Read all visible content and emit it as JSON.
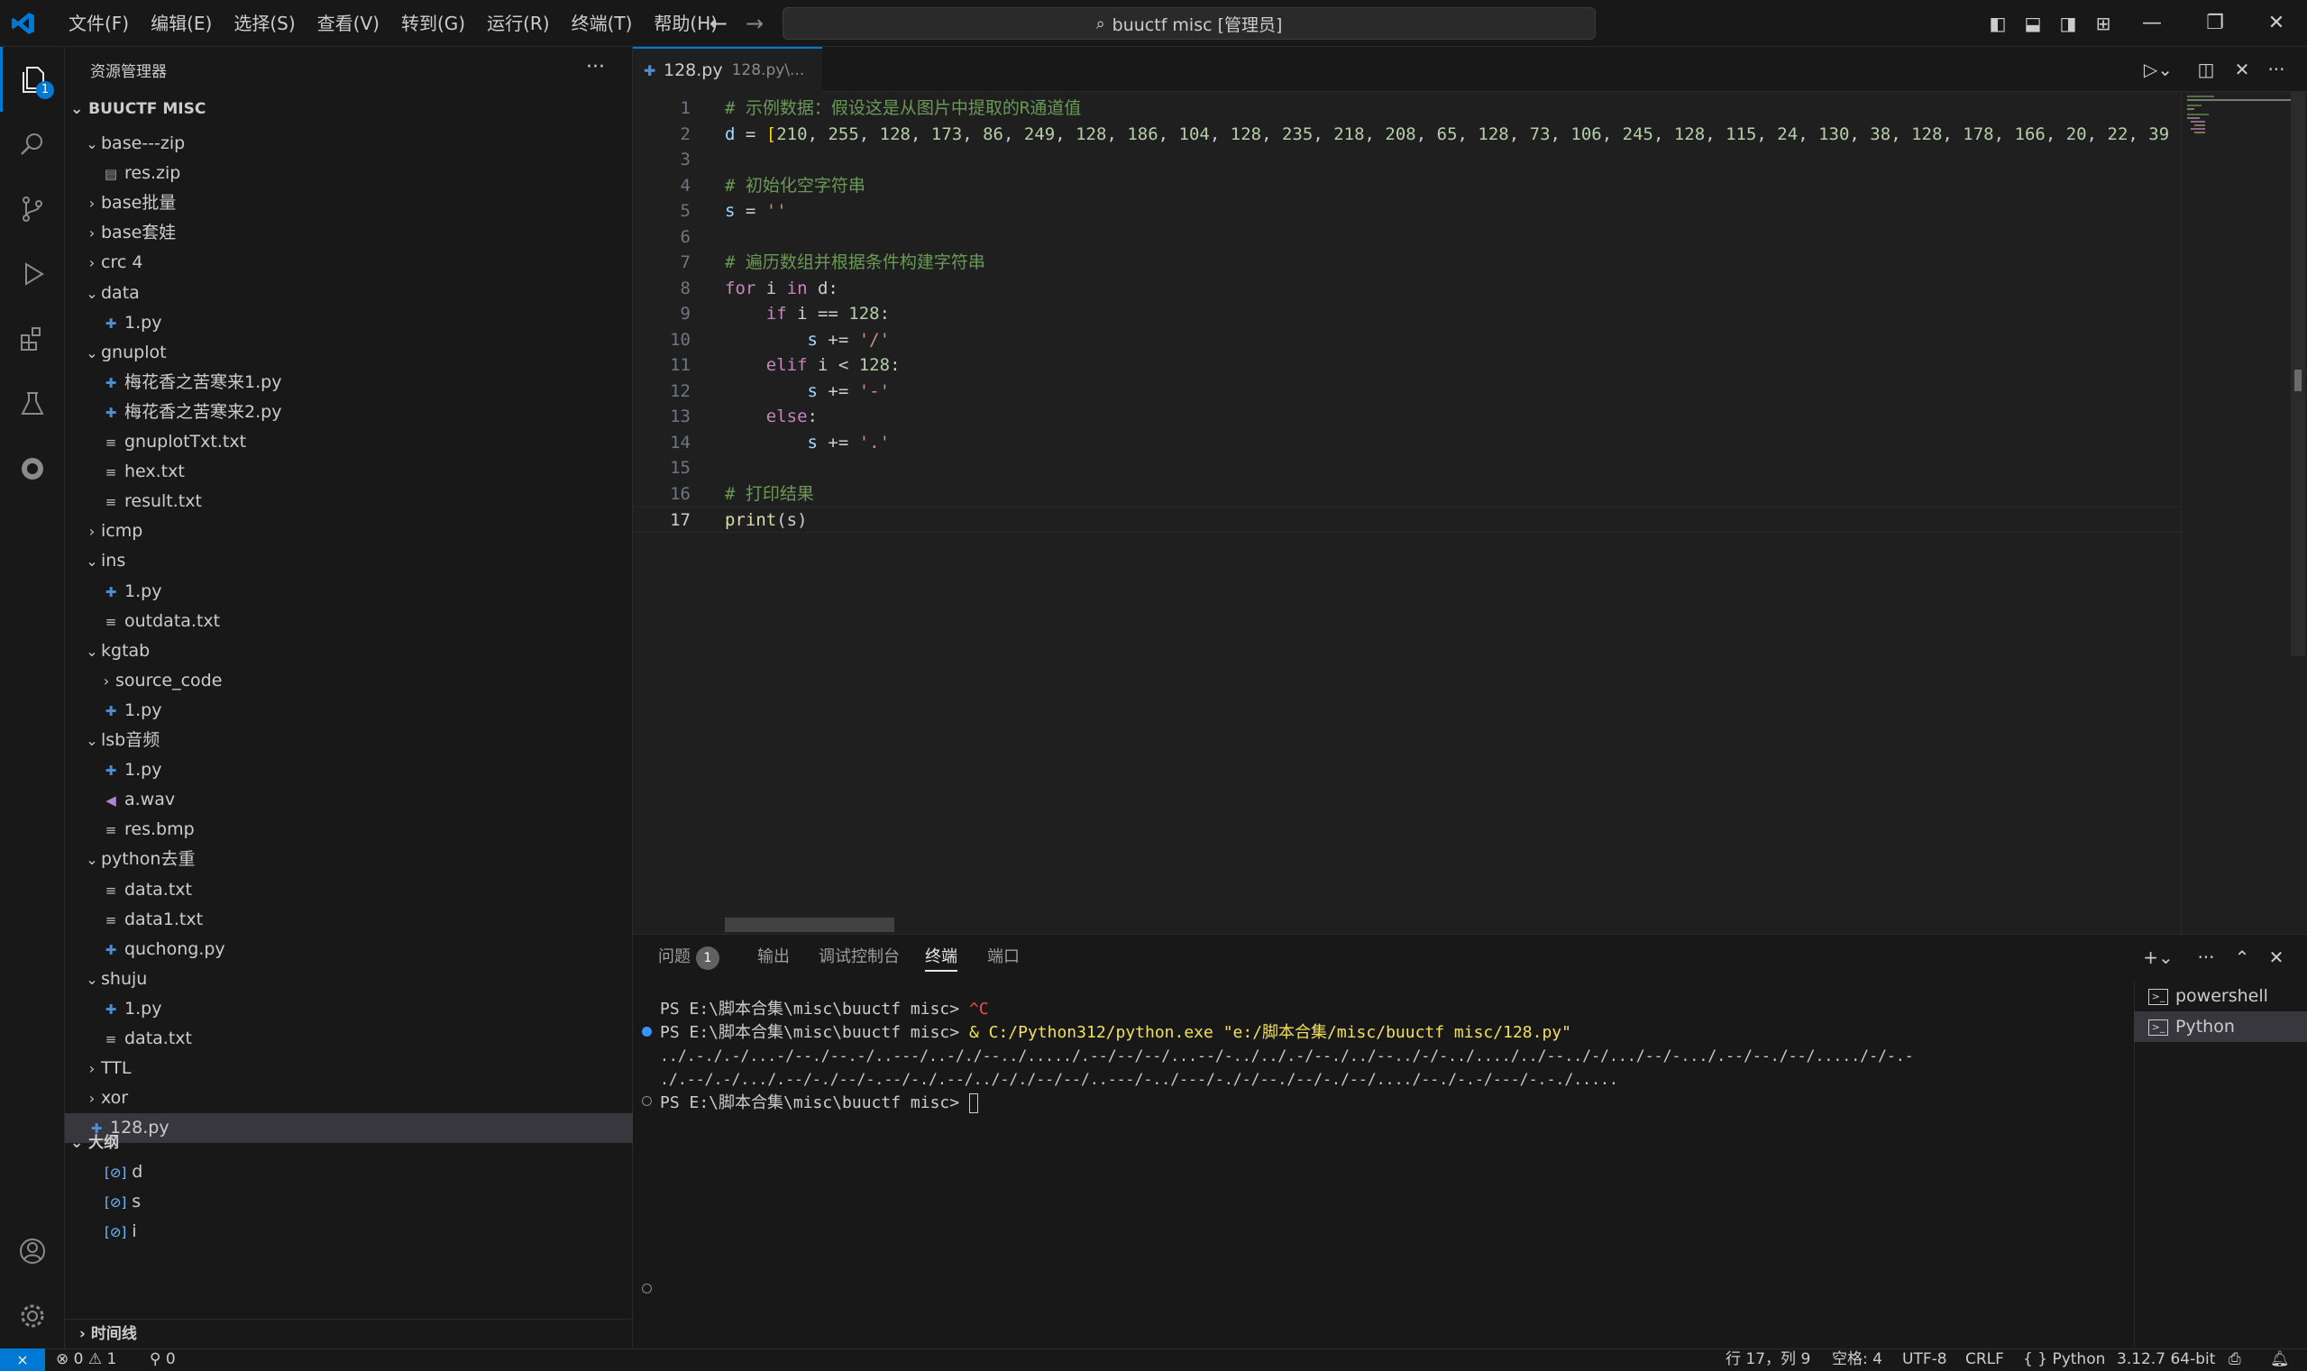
{
  "menu": [
    "文件(F)",
    "编辑(E)",
    "选择(S)",
    "查看(V)",
    "转到(G)",
    "运行(R)",
    "终端(T)",
    "帮助(H)"
  ],
  "command_center": "buuctf misc [管理员]",
  "activity": {
    "explorer_badge": "1"
  },
  "sidebar": {
    "title": "资源管理器",
    "more": "···",
    "section": "BUUCTF MISC",
    "tree": [
      {
        "label": "base---zip",
        "type": "folder-open",
        "depth": 0
      },
      {
        "label": "res.zip",
        "type": "zip",
        "depth": 1
      },
      {
        "label": "base批量",
        "type": "folder",
        "depth": 0
      },
      {
        "label": "base套娃",
        "type": "folder",
        "depth": 0
      },
      {
        "label": "crc 4",
        "type": "folder",
        "depth": 0
      },
      {
        "label": "data",
        "type": "folder-open",
        "depth": 0
      },
      {
        "label": "1.py",
        "type": "py",
        "depth": 1
      },
      {
        "label": "gnuplot",
        "type": "folder-open",
        "depth": 0
      },
      {
        "label": "梅花香之苦寒来1.py",
        "type": "py",
        "depth": 1
      },
      {
        "label": "梅花香之苦寒来2.py",
        "type": "py",
        "depth": 1
      },
      {
        "label": "gnuplotTxt.txt",
        "type": "txt",
        "depth": 1
      },
      {
        "label": "hex.txt",
        "type": "txt",
        "depth": 1
      },
      {
        "label": "result.txt",
        "type": "txt",
        "depth": 1
      },
      {
        "label": "icmp",
        "type": "folder",
        "depth": 0
      },
      {
        "label": "ins",
        "type": "folder-open",
        "depth": 0
      },
      {
        "label": "1.py",
        "type": "py",
        "depth": 1
      },
      {
        "label": "outdata.txt",
        "type": "txt",
        "depth": 1
      },
      {
        "label": "kgtab",
        "type": "folder-open",
        "depth": 0
      },
      {
        "label": "source_code",
        "type": "folder",
        "depth": 1
      },
      {
        "label": "1.py",
        "type": "py",
        "depth": 1
      },
      {
        "label": "lsb音频",
        "type": "folder-open",
        "depth": 0
      },
      {
        "label": "1.py",
        "type": "py",
        "depth": 1
      },
      {
        "label": "a.wav",
        "type": "wav",
        "depth": 1
      },
      {
        "label": "res.bmp",
        "type": "txt",
        "depth": 1
      },
      {
        "label": "python去重",
        "type": "folder-open",
        "depth": 0
      },
      {
        "label": "data.txt",
        "type": "txt",
        "depth": 1
      },
      {
        "label": "data1.txt",
        "type": "txt",
        "depth": 1
      },
      {
        "label": "quchong.py",
        "type": "py",
        "depth": 1
      },
      {
        "label": "shuju",
        "type": "folder-open",
        "depth": 0
      },
      {
        "label": "1.py",
        "type": "py",
        "depth": 1
      },
      {
        "label": "data.txt",
        "type": "txt",
        "depth": 1
      },
      {
        "label": "TTL",
        "type": "folder",
        "depth": 0
      },
      {
        "label": "xor",
        "type": "folder",
        "depth": 0
      },
      {
        "label": "128.py",
        "type": "py",
        "depth": 0,
        "selected": true
      }
    ],
    "outline_title": "大纲",
    "outline": [
      "d",
      "s",
      "i"
    ],
    "timeline": "时间线"
  },
  "editor": {
    "tab_name": "128.py",
    "tab_path": "128.py\\...",
    "lines": [
      "# 示例数据：假设这是从图片中提取的R通道值",
      "d = [210, 255, 128, 173, 86, 249, 128, 186, 104, 128, 235, 218, 208, 65, 128, 73, 106, 245, 128, 115, 24, 130, 38, 128, 178, 166, 20, 22, 39",
      "",
      "# 初始化空字符串",
      "s = ''",
      "",
      "# 遍历数组并根据条件构建字符串",
      "for i in d:",
      "    if i == 128:",
      "        s += '/'",
      "    elif i < 128:",
      "        s += '-'",
      "    else:",
      "        s += '.'",
      "",
      "# 打印结果",
      "print(s)"
    ]
  },
  "panel": {
    "tabs": [
      "问题",
      "输出",
      "调试控制台",
      "终端",
      "端口"
    ],
    "problems_count": "1",
    "terminal_lines": [
      {
        "prompt": "PS E:\\脚本合集\\misc\\buuctf misc> ",
        "cmd": "^C"
      },
      {
        "prompt": "PS E:\\脚本合集\\misc\\buuctf misc> ",
        "cmd": "& C:/Python312/python.exe \"e:/脚本合集/misc/buuctf misc/128.py\""
      },
      {
        "prompt": "",
        "cmd": "../.-./.-/...-/--./--.-/..---/..-/./--../...../.--/--/--/...--/-../../.-/--./../--../-/-../..../../--../-/.../--/-.../.--/--./--/...../-/-.-"
      },
      {
        "prompt": "",
        "cmd": "./.--/.-/.../.--/-./--/-.--/-./.--/../-/./--/--/..---/-../---/-./-/--./--/-./--/..../--./-.-/---/-.-./....."
      },
      {
        "prompt": "PS E:\\脚本合集\\misc\\buuctf misc> ",
        "cmd": ""
      }
    ],
    "terminals": [
      "powershell",
      "Python"
    ]
  },
  "status": {
    "errors": "0",
    "warnings": "1",
    "ports": "0",
    "position": "行 17，列 9",
    "spaces": "空格: 4",
    "encoding": "UTF-8",
    "eol": "CRLF",
    "language": "Python",
    "interpreter": "3.12.7 64-bit"
  }
}
